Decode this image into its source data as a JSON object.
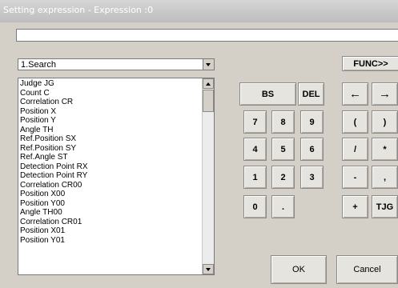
{
  "window": {
    "title": "Setting expression - Expression :0"
  },
  "expression": {
    "value": ""
  },
  "category": {
    "selected": "1.Search"
  },
  "list": {
    "items": [
      "Judge JG",
      "Count C",
      "Correlation CR",
      "Position X",
      "Position Y",
      "Angle TH",
      "Ref.Position SX",
      "Ref.Position SY",
      "Ref.Angle ST",
      "Detection Point RX",
      "Detection Point RY",
      "Correlation CR00",
      "Position X00",
      "Position Y00",
      "Angle TH00",
      "Correlation CR01",
      "Position X01",
      "Position Y01"
    ]
  },
  "keypad": {
    "bs": "BS",
    "del": "DEL",
    "d7": "7",
    "d8": "8",
    "d9": "9",
    "d4": "4",
    "d5": "5",
    "d6": "6",
    "d1": "1",
    "d2": "2",
    "d3": "3",
    "d0": "0",
    "dot": "."
  },
  "operators": {
    "left": "←",
    "right": "→",
    "open_paren": "(",
    "close_paren": ")",
    "divide": "/",
    "multiply": "*",
    "minus": "-",
    "comma": ",",
    "plus": "+",
    "tjg": "TJG"
  },
  "func_label": "FUNC>>",
  "ok_label": "OK",
  "cancel_label": "Cancel"
}
